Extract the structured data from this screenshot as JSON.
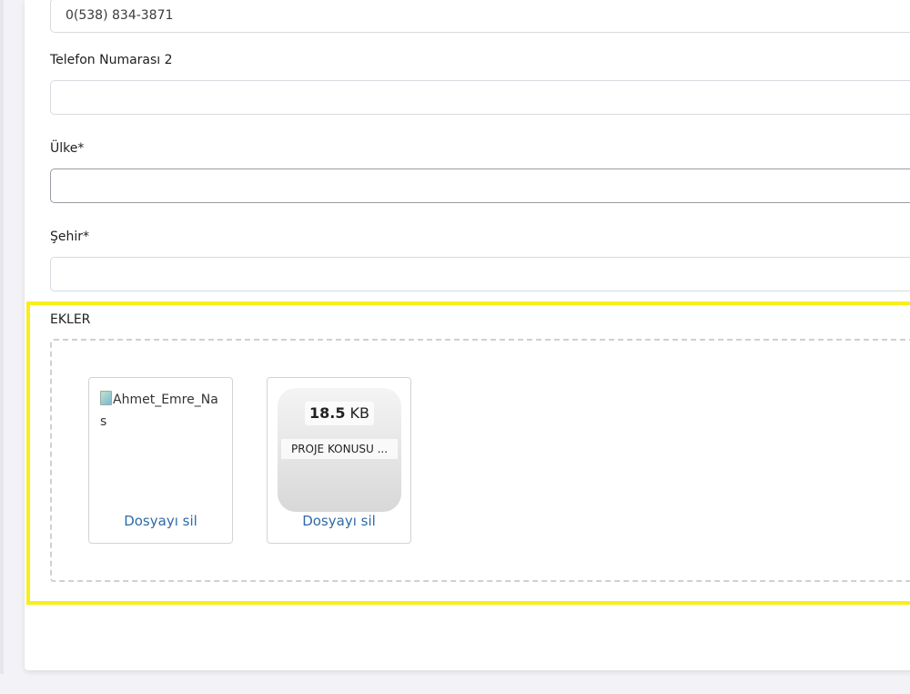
{
  "form": {
    "phone1_value": "0(538) 834-3871",
    "phone2_label": "Telefon Numarası 2",
    "phone2_value": "",
    "country_label": "Ülke*",
    "country_value": "",
    "city_label": "Şehir*",
    "city_value": ""
  },
  "attachments": {
    "title": "EKLER",
    "files": [
      {
        "alt_text": "Ahmet_Emre_Nas",
        "remove_label": "Dosyayı sil"
      },
      {
        "size_number": "18.5",
        "size_unit": "KB",
        "filename": "PROJE KONUSU ...",
        "remove_label": "Dosyayı sil"
      }
    ]
  },
  "colors": {
    "highlight": "#f8ee1a",
    "link": "#2f6aa8"
  }
}
